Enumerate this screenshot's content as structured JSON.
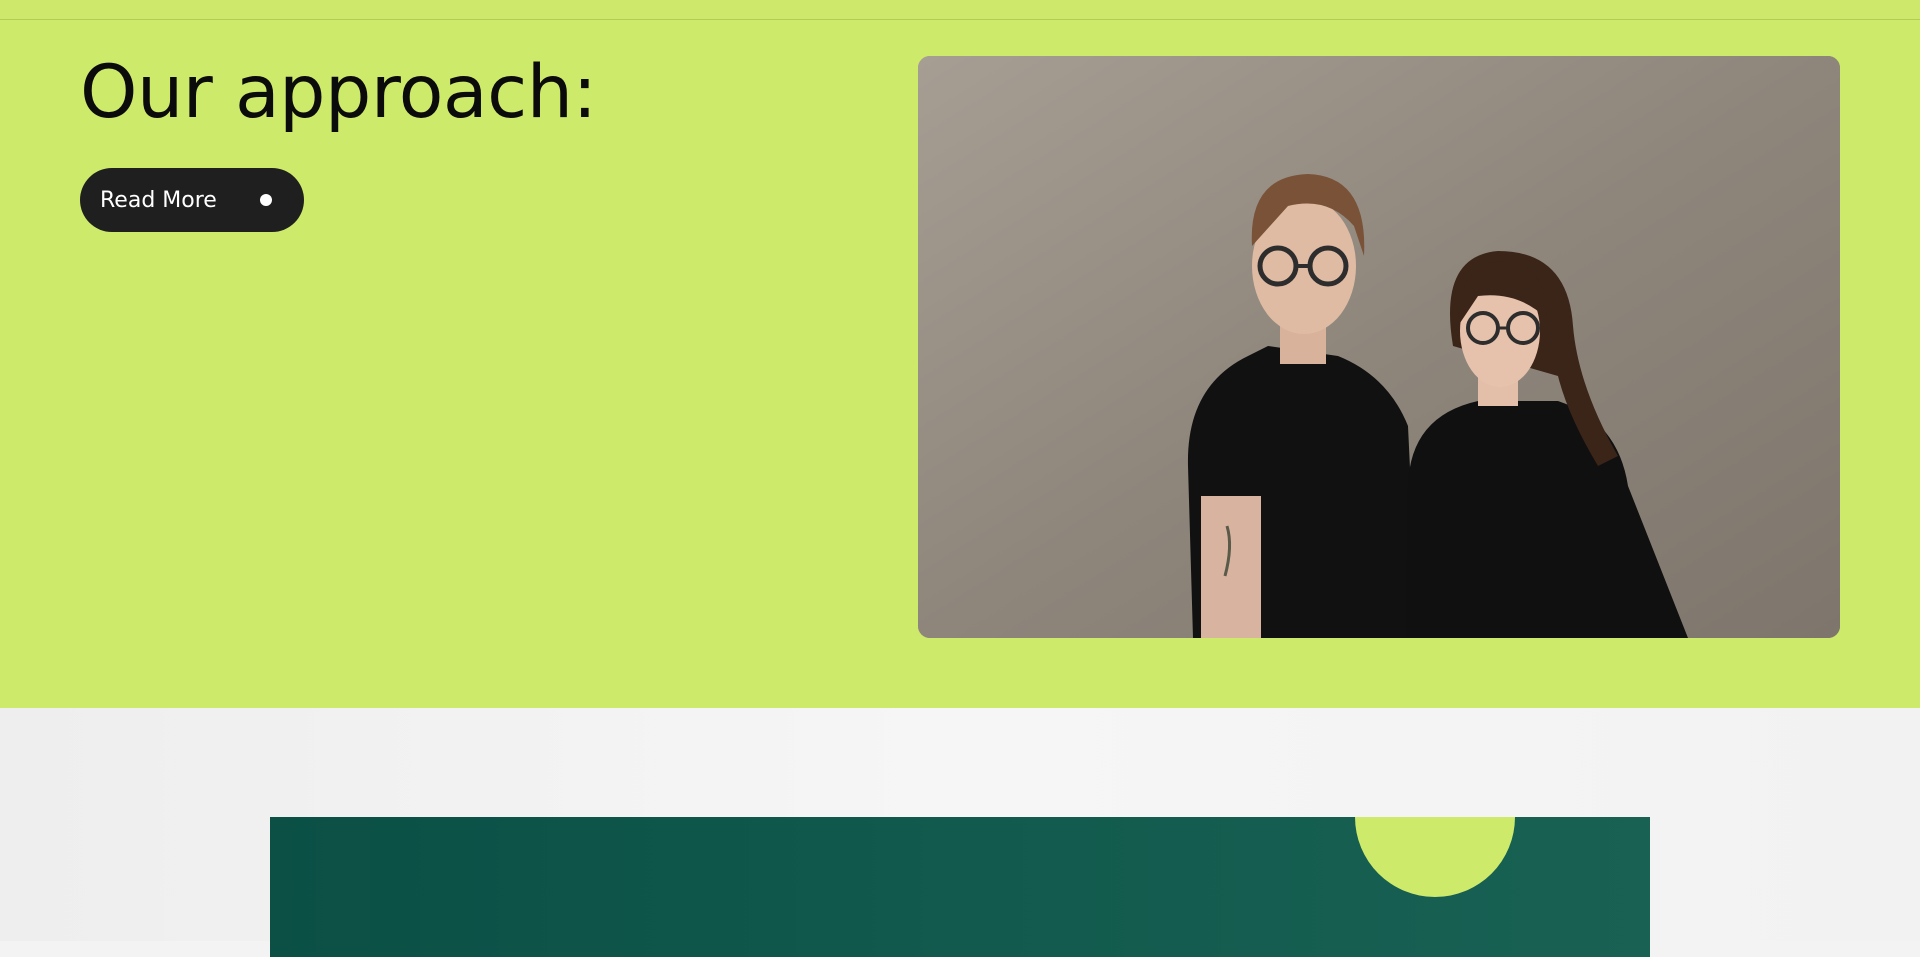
{
  "hero": {
    "title": "Our approach:",
    "read_more_label": "Read More",
    "photo_alt": "Two people in black shirts and glasses standing against a concrete wall"
  },
  "colors": {
    "accent_lime": "#cdea6b",
    "button_dark": "#1f1f1f",
    "teal": "#115a4d"
  },
  "icons": {
    "read_more_indicator": "dot-icon"
  }
}
